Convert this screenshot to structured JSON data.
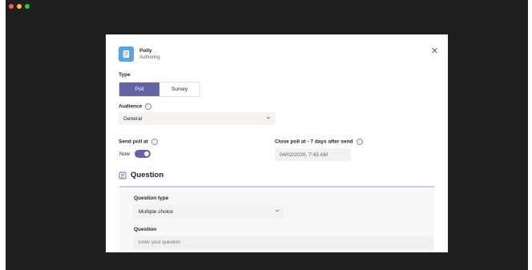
{
  "app": {
    "name": "Polly",
    "subtitle": "Authoring"
  },
  "type": {
    "label": "Type",
    "options": [
      "Poll",
      "Survey"
    ],
    "selected": "Poll"
  },
  "audience": {
    "label": "Audience",
    "value": "General"
  },
  "send": {
    "label": "Send poll at",
    "now_label": "Now",
    "toggle_on": true
  },
  "close": {
    "label": "Close poll at - 7 days after send",
    "value": "04/02/2020, 7:43 AM"
  },
  "section": {
    "title": "Question"
  },
  "question_type": {
    "label": "Question type",
    "value": "Multiple choice"
  },
  "question": {
    "label": "Question",
    "placeholder": "Enter your question"
  },
  "colors": {
    "accent": "#6264a7",
    "window_bg": "#201f1f",
    "app_icon": "#5aa2e0"
  },
  "icons": {
    "close": "close-icon",
    "info": "info-icon",
    "chevron": "chevron-down-icon",
    "section": "form-icon",
    "app": "poll-app-icon"
  }
}
